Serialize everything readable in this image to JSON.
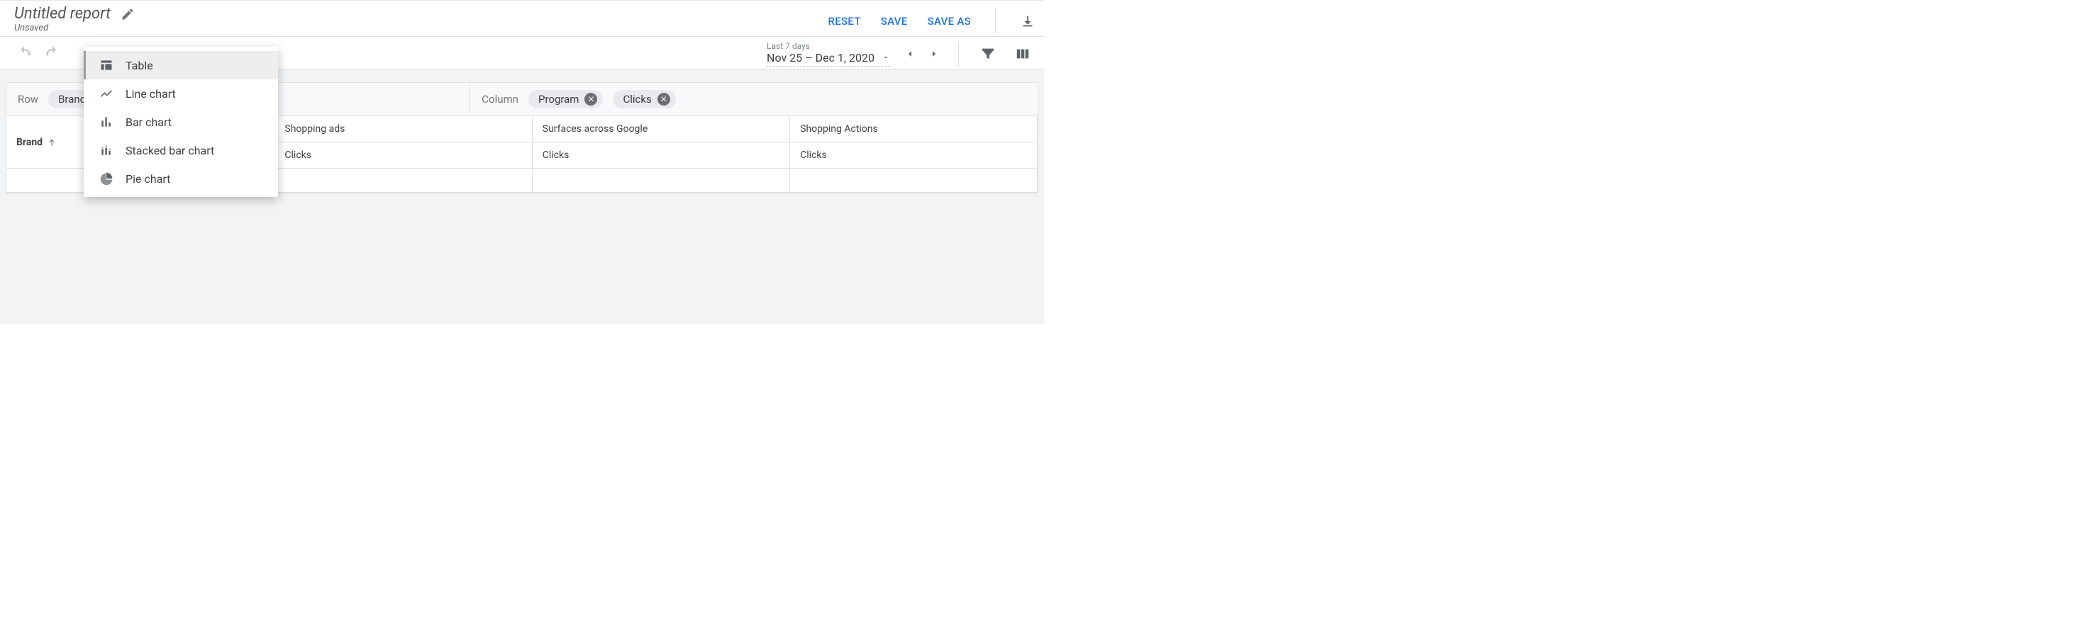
{
  "header": {
    "title": "Untitled report",
    "status": "Unsaved",
    "actions": {
      "reset": "RESET",
      "save": "SAVE",
      "save_as": "SAVE AS"
    }
  },
  "date_picker": {
    "preset_label": "Last 7 days",
    "range": "Nov 25 – Dec 1, 2020"
  },
  "chart_menu": {
    "items": [
      {
        "label": "Table",
        "selected": true
      },
      {
        "label": "Line chart",
        "selected": false
      },
      {
        "label": "Bar chart",
        "selected": false
      },
      {
        "label": "Stacked bar chart",
        "selected": false
      },
      {
        "label": "Pie chart",
        "selected": false
      }
    ]
  },
  "chips": {
    "row_label": "Row",
    "row": [
      "Brand"
    ],
    "column_label": "Column",
    "column": [
      "Program",
      "Clicks"
    ]
  },
  "table": {
    "row_header": "Brand",
    "group_headers": [
      "Shopping ads",
      "Surfaces across Google",
      "Shopping Actions"
    ],
    "sub_header": "Clicks"
  }
}
